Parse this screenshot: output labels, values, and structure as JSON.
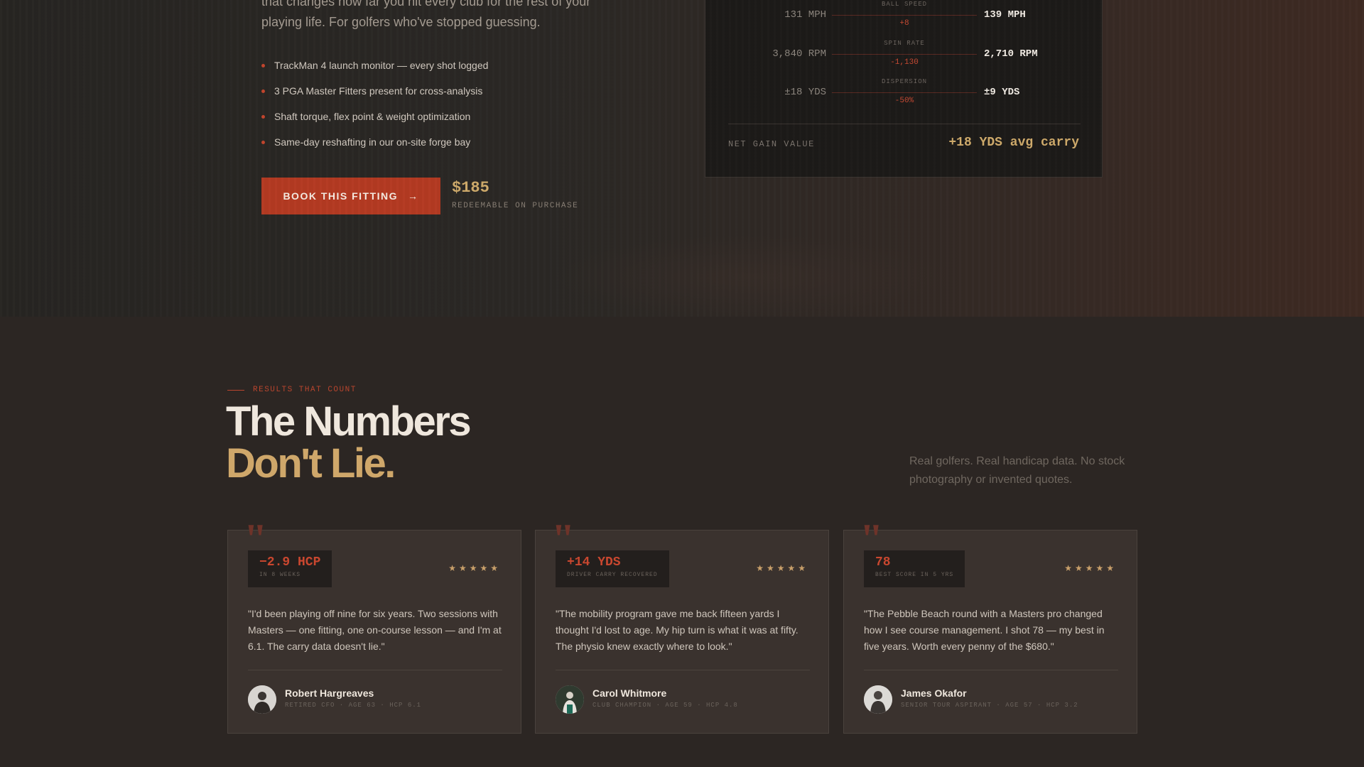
{
  "intro": {
    "line1": "that changes how far you hit every club for the rest of your",
    "line2": "playing life. For golfers who've stopped guessing."
  },
  "bullets": [
    "TrackMan 4 launch monitor — every shot logged",
    "3 PGA Master Fitters present for cross-analysis",
    "Shaft torque, flex point & weight optimization",
    "Same-day reshafting in our on-site forge bay"
  ],
  "cta": {
    "label": "BOOK THIS FITTING",
    "arrow": "→",
    "price": "$185",
    "price_note": "REDEEMABLE ON PURCHASE"
  },
  "metrics": {
    "rows": [
      {
        "label": "BALL SPEED",
        "before": "131 MPH",
        "delta": "+8",
        "after": "139 MPH"
      },
      {
        "label": "SPIN RATE",
        "before": "3,840 RPM",
        "delta": "-1,130",
        "after": "2,710 RPM"
      },
      {
        "label": "DISPERSION",
        "before": "±18 YDS",
        "delta": "-50%",
        "after": "±9 YDS"
      }
    ],
    "net_label": "NET GAIN VALUE",
    "net_value": "+18 YDS avg carry"
  },
  "results": {
    "eyebrow": "RESULTS THAT COUNT",
    "title_line1": "The Numbers",
    "title_line2": "Don't Lie.",
    "side_text": "Real golfers. Real handicap data. No stock photography or invented quotes."
  },
  "testimonials": [
    {
      "stat": "−2.9 HCP",
      "stat_sub": "IN 8 WEEKS",
      "stars": "★★★★★",
      "quote": "\"I'd been playing off nine for six years. Two sessions with Masters — one fitting, one on-course lesson — and I'm at 6.1. The carry data doesn't lie.\"",
      "name": "Robert Hargreaves",
      "meta": "RETIRED CFO · AGE 63 · HCP 6.1"
    },
    {
      "stat": "+14 YDS",
      "stat_sub": "DRIVER CARRY RECOVERED",
      "stars": "★★★★★",
      "quote": "\"The mobility program gave me back fifteen yards I thought I'd lost to age. My hip turn is what it was at fifty. The physio knew exactly where to look.\"",
      "name": "Carol Whitmore",
      "meta": "CLUB CHAMPION · AGE 59 · HCP 4.8"
    },
    {
      "stat": "78",
      "stat_sub": "BEST SCORE IN 5 YRS",
      "stars": "★★★★★",
      "quote": "\"The Pebble Beach round with a Masters pro changed how I see course management. I shot 78 — my best in five years. Worth every penny of the $680.\"",
      "name": "James Okafor",
      "meta": "SENIOR TOUR ASPIRANT · AGE 57 · HCP 3.2"
    }
  ],
  "colors": {
    "accent_red": "#b43a22",
    "accent_gold": "#cfa76a",
    "background": "#2c2623"
  },
  "icons": {
    "cta_arrow": "arrow-right-icon",
    "quote": "quote-mark-icon",
    "rating": "star-icon",
    "avatar": "user-photo"
  }
}
